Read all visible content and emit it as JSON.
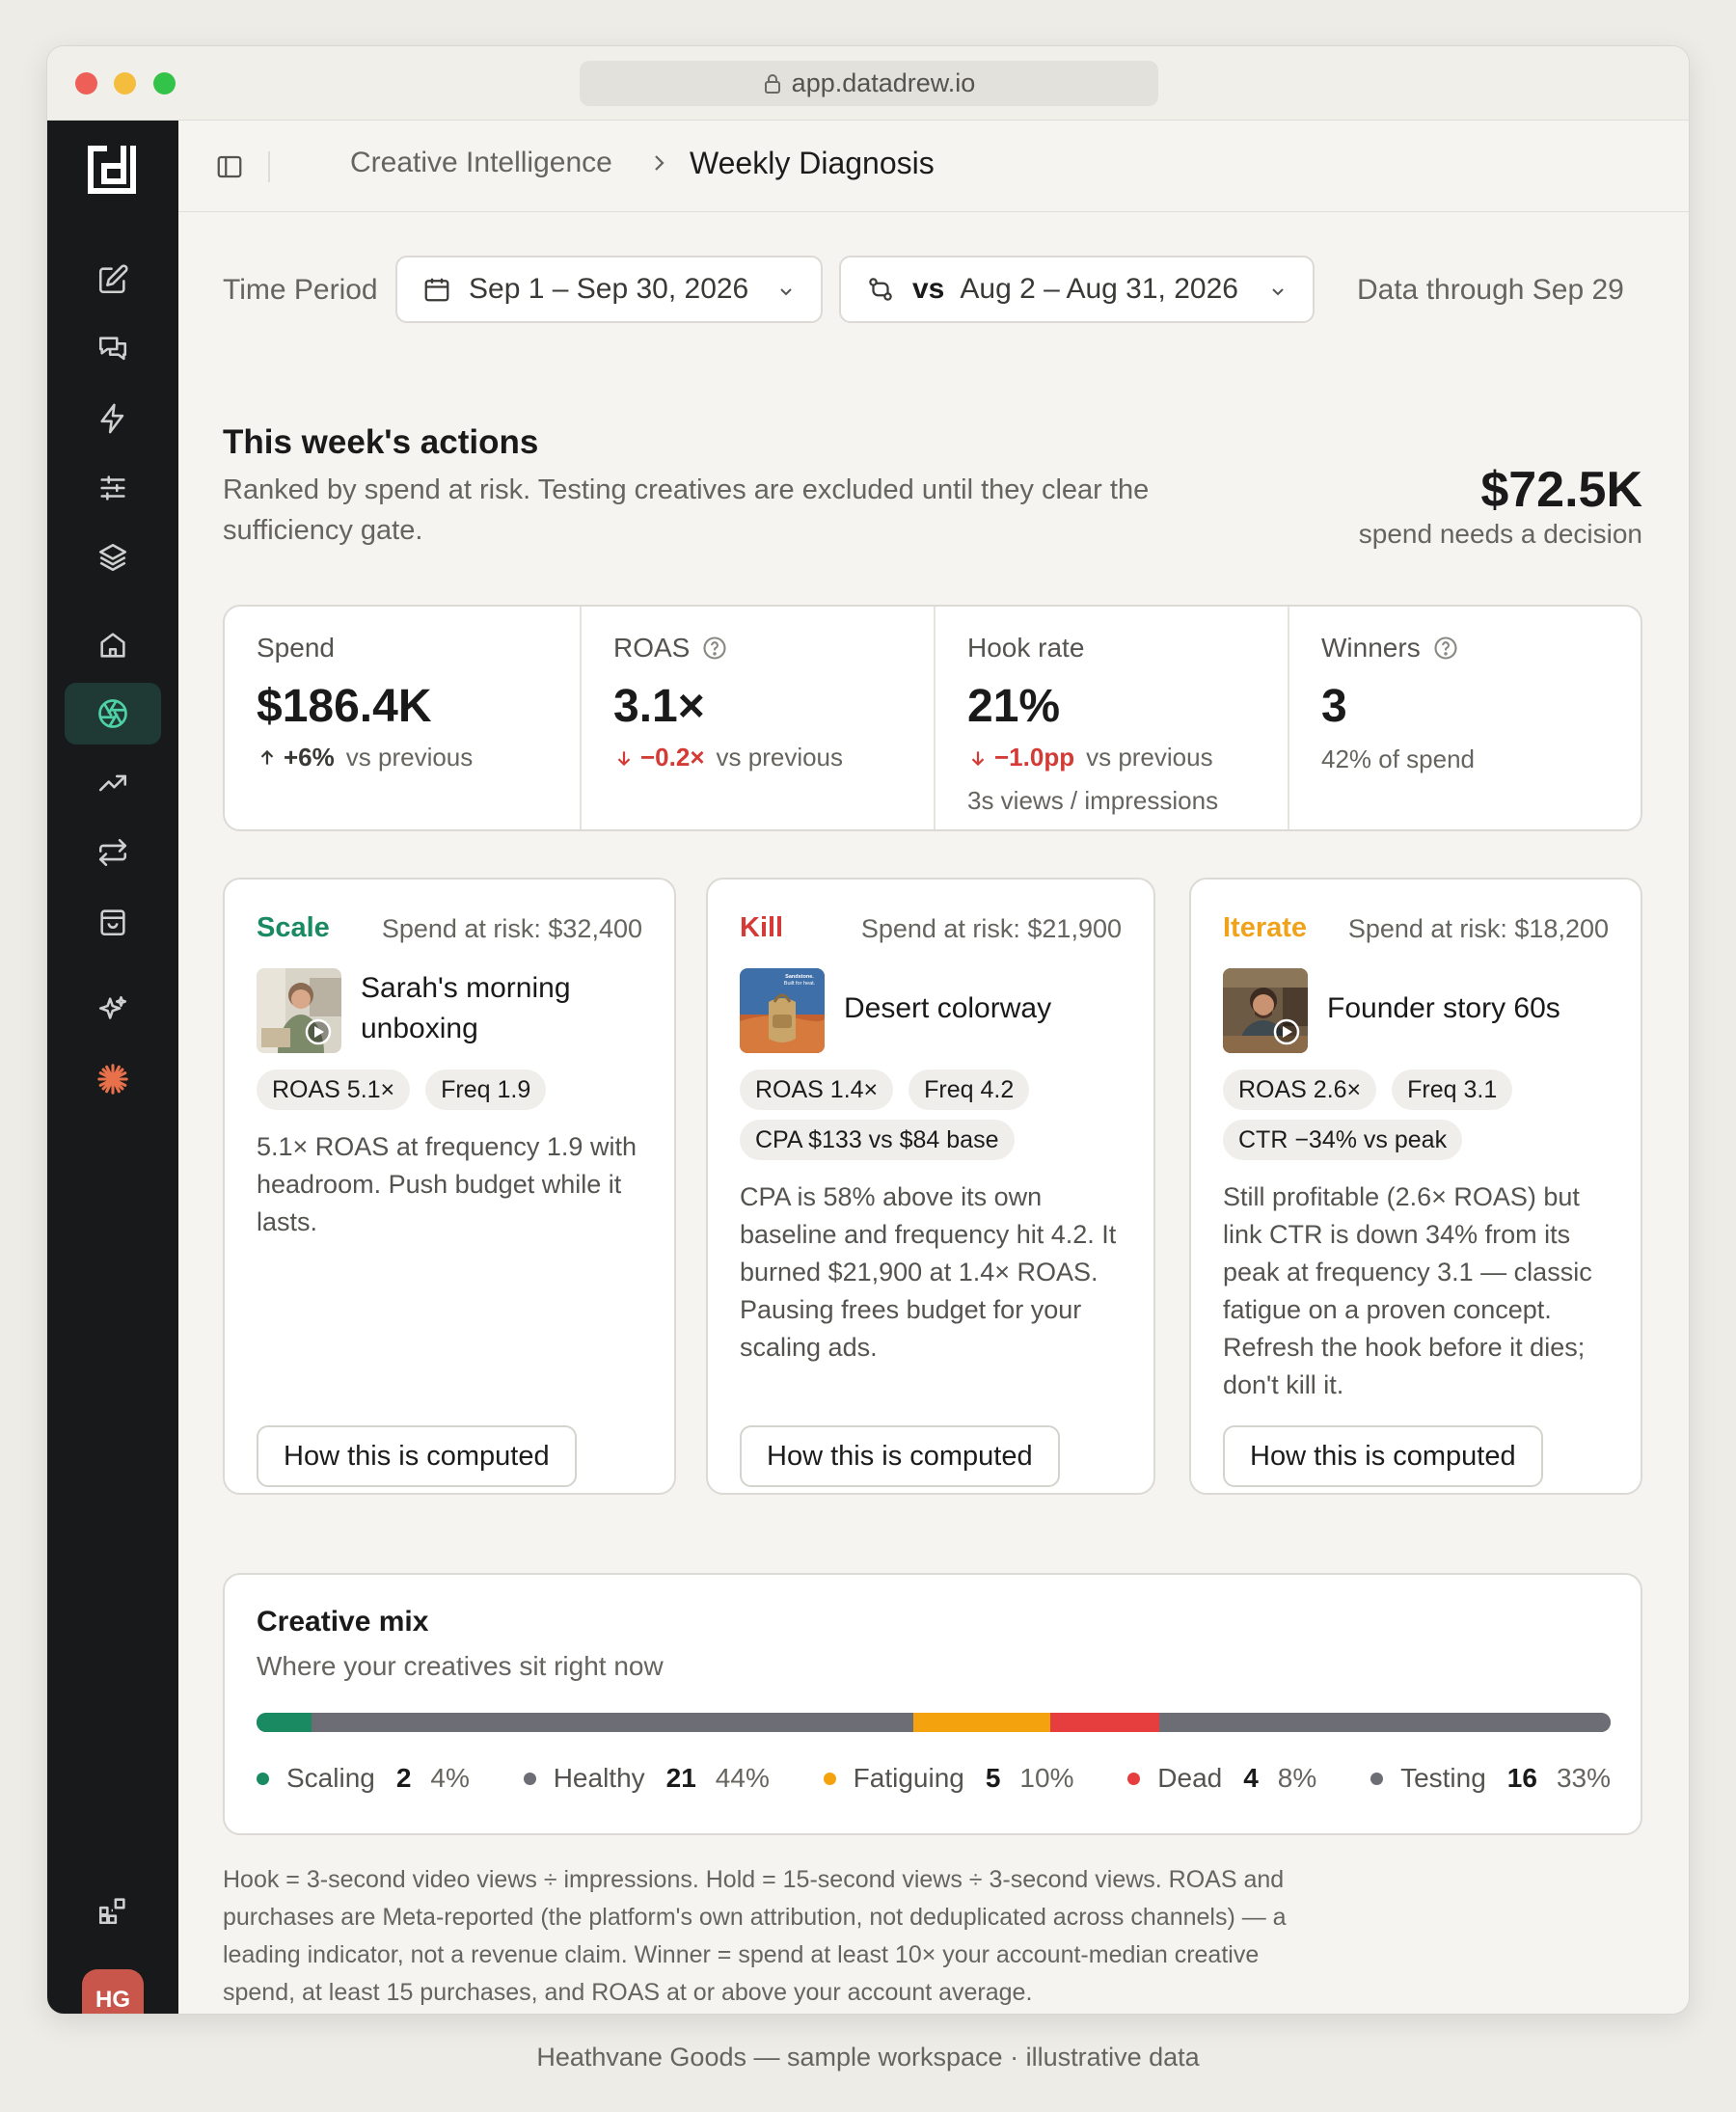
{
  "browser": {
    "url": "app.datadrew.io"
  },
  "sidebar": {
    "items": [
      {
        "icon": "edit-icon"
      },
      {
        "icon": "chat-icon"
      },
      {
        "icon": "bolt-icon"
      },
      {
        "icon": "sliders-icon"
      },
      {
        "icon": "layers-icon"
      },
      {
        "icon": "home-icon"
      },
      {
        "icon": "aperture-icon",
        "active": true
      },
      {
        "icon": "trend-icon"
      },
      {
        "icon": "swap-icon"
      },
      {
        "icon": "bag-icon"
      },
      {
        "icon": "sparkle-icon"
      },
      {
        "icon": "burst-icon"
      }
    ],
    "avatar_initials": "HG"
  },
  "breadcrumb": {
    "parent": "Creative Intelligence",
    "current": "Weekly Diagnosis"
  },
  "filters": {
    "time_period_label": "Time Period",
    "range": "Sep 1 – Sep 30, 2026",
    "compare_prefix": "vs",
    "compare_range": "Aug 2 – Aug 31, 2026",
    "data_through": "Data through Sep 29"
  },
  "actions": {
    "title": "This week's actions",
    "subtitle": "Ranked by spend at risk. Testing creatives are excluded until they clear the sufficiency gate.",
    "risk_amount": "$72.5K",
    "risk_label": "spend needs a decision"
  },
  "kpis": {
    "spend": {
      "label": "Spend",
      "value": "$186.4K",
      "delta": "+6%",
      "suffix": "vs previous"
    },
    "roas": {
      "label": "ROAS",
      "value": "3.1×",
      "delta": "−0.2×",
      "suffix": "vs previous"
    },
    "hook": {
      "label": "Hook rate",
      "value": "21%",
      "delta": "−1.0pp",
      "suffix": "vs previous",
      "note": "3s views / impressions"
    },
    "winners": {
      "label": "Winners",
      "value": "3",
      "note": "42% of spend"
    }
  },
  "cards": [
    {
      "verdict": "Scale",
      "color": "#1a8a62",
      "risk": "Spend at risk: $32,400",
      "name": "Sarah's morning unboxing",
      "chips": [
        "ROAS 5.1×",
        "Freq 1.9"
      ],
      "desc": "5.1× ROAS at frequency 1.9 with headroom. Push budget while it lasts.",
      "button": "How this is computed"
    },
    {
      "verdict": "Kill",
      "color": "#d43a36",
      "risk": "Spend at risk: $21,900",
      "name": "Desert colorway",
      "thumb_caption": "Sandstone. Built for heat.",
      "chips": [
        "ROAS 1.4×",
        "Freq 4.2",
        "CPA $133 vs $84 base"
      ],
      "desc": "CPA is 58% above its own baseline and frequency hit 4.2. It burned $21,900 at 1.4× ROAS. Pausing frees budget for your scaling ads.",
      "button": "How this is computed"
    },
    {
      "verdict": "Iterate",
      "color": "#f0a21a",
      "risk": "Spend at risk: $18,200",
      "name": "Founder story 60s",
      "chips": [
        "ROAS 2.6×",
        "Freq 3.1",
        "CTR −34% vs peak"
      ],
      "desc": "Still profitable (2.6× ROAS) but link CTR is down 34% from its peak at frequency 3.1 — classic fatigue on a proven concept. Refresh the hook before it dies; don't kill it.",
      "button": "How this is computed"
    }
  ],
  "mix": {
    "title": "Creative mix",
    "subtitle": "Where your creatives sit right now",
    "segments": [
      {
        "label": "Scaling",
        "count": "2",
        "pct": "4%",
        "share": 4,
        "color": "#1a8a62"
      },
      {
        "label": "Healthy",
        "count": "21",
        "pct": "44%",
        "share": 44,
        "color": "#6c6d75"
      },
      {
        "label": "Fatiguing",
        "count": "5",
        "pct": "10%",
        "share": 10,
        "color": "#f5a20f"
      },
      {
        "label": "Dead",
        "count": "4",
        "pct": "8%",
        "share": 8,
        "color": "#e63e3e"
      },
      {
        "label": "Testing",
        "count": "16",
        "pct": "33%",
        "share": 33,
        "color": "#6c6d75"
      }
    ]
  },
  "footnote": "Hook = 3-second video views ÷ impressions. Hold = 15-second views ÷ 3-second views. ROAS and purchases are Meta-reported (the platform's own attribution, not deduplicated across channels) — a leading indicator, not a revenue claim. Winner = spend at least 10× your account-median creative spend, at least 15 purchases, and ROAS at or above your account average.",
  "caption": "Heathvane Goods — sample workspace · illustrative data"
}
